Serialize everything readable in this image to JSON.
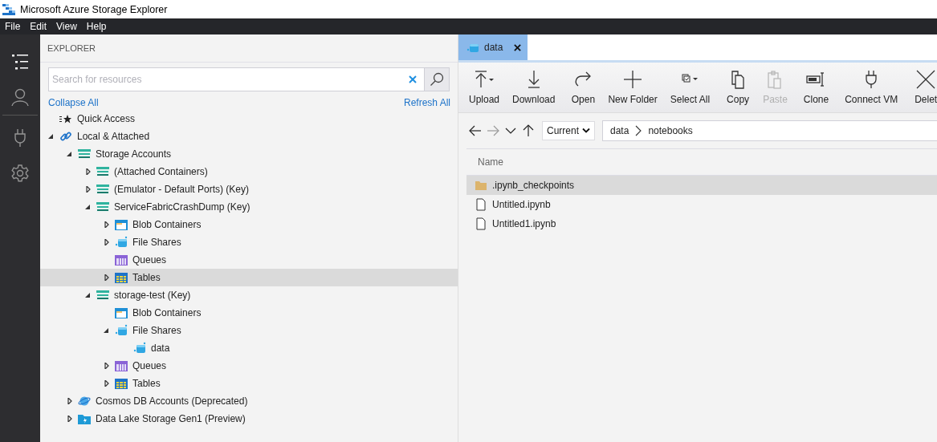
{
  "window": {
    "title": "Microsoft Azure Storage Explorer"
  },
  "menu": [
    "File",
    "Edit",
    "View",
    "Help"
  ],
  "activity_bar": [
    {
      "kind": "explorer",
      "selected": true
    },
    {
      "kind": "account",
      "selected": false
    },
    {
      "kind": "connect",
      "selected": false
    },
    {
      "kind": "settings",
      "selected": false
    }
  ],
  "explorer": {
    "heading": "EXPLORER",
    "search": {
      "placeholder": "Search for resources"
    },
    "collapse_all": "Collapse All",
    "refresh_all": "Refresh All",
    "tree": [
      {
        "label": "Quick Access",
        "kind": "quick",
        "selected": false
      },
      {
        "label": "Local & Attached",
        "kind": "link",
        "expanded": true,
        "selected": false,
        "children": [
          {
            "label": "Storage Accounts",
            "kind": "account",
            "expanded": true,
            "selected": false,
            "children": [
              {
                "label": "(Attached Containers)",
                "kind": "account",
                "expanded": false,
                "selected": false
              },
              {
                "label": "(Emulator - Default Ports) (Key)",
                "kind": "account",
                "expanded": false,
                "selected": false
              },
              {
                "label": "ServiceFabricCrashDump (Key)",
                "kind": "account",
                "expanded": true,
                "selected": false,
                "children": [
                  {
                    "label": "Blob Containers",
                    "kind": "blob",
                    "expanded": false,
                    "selected": false
                  },
                  {
                    "label": "File Shares",
                    "kind": "share",
                    "expanded": false,
                    "selected": false
                  },
                  {
                    "label": "Queues",
                    "kind": "queue",
                    "selected": false
                  },
                  {
                    "label": "Tables",
                    "kind": "table",
                    "expanded": false,
                    "selected": true
                  }
                ]
              },
              {
                "label": "storage-test (Key)",
                "kind": "account",
                "expanded": true,
                "selected": false,
                "children": [
                  {
                    "label": "Blob Containers",
                    "kind": "blob",
                    "selected": false
                  },
                  {
                    "label": "File Shares",
                    "kind": "share",
                    "expanded": true,
                    "selected": false,
                    "children": [
                      {
                        "label": "data",
                        "kind": "share",
                        "selected": false
                      }
                    ]
                  },
                  {
                    "label": "Queues",
                    "kind": "queue",
                    "expanded": false,
                    "selected": false
                  },
                  {
                    "label": "Tables",
                    "kind": "table",
                    "expanded": false,
                    "selected": false
                  }
                ]
              }
            ]
          },
          {
            "label": "Cosmos DB Accounts (Deprecated)",
            "kind": "cosmos",
            "expanded": false,
            "selected": false
          },
          {
            "label": "Data Lake Storage Gen1 (Preview)",
            "kind": "datalake",
            "expanded": false,
            "selected": false
          }
        ]
      }
    ]
  },
  "tabs": [
    {
      "label": "data",
      "selected": true
    }
  ],
  "toolbar": {
    "groups": [
      [
        {
          "label": "Upload",
          "kind": "upload",
          "disabled": false
        },
        {
          "label": "Download",
          "kind": "download",
          "disabled": false
        }
      ],
      [
        {
          "label": "Open",
          "kind": "open",
          "disabled": false
        },
        {
          "label": "New Folder",
          "kind": "newfolder",
          "disabled": false
        },
        {
          "label": "Select All",
          "kind": "selectall",
          "disabled": false
        }
      ],
      [
        {
          "label": "Copy",
          "kind": "copy",
          "disabled": false
        },
        {
          "label": "Paste",
          "kind": "paste",
          "disabled": true
        }
      ],
      [
        {
          "label": "Clone",
          "kind": "clone",
          "disabled": false
        }
      ],
      [
        {
          "label": "Connect VM",
          "kind": "connect",
          "disabled": false
        }
      ],
      [
        {
          "label": "Delet",
          "kind": "delete",
          "disabled": false
        }
      ]
    ]
  },
  "navigation": {
    "buttons": [
      {
        "kind": "back",
        "disabled": false
      },
      {
        "kind": "forward",
        "disabled": true
      },
      {
        "kind": "recent",
        "disabled": false
      },
      {
        "kind": "up",
        "disabled": false
      }
    ],
    "scope": "Current",
    "path": [
      "data",
      "notebooks"
    ]
  },
  "files": {
    "columns": [
      "Name"
    ],
    "rows": [
      {
        "name": ".ipynb_checkpoints",
        "kind": "folder",
        "selected": true
      },
      {
        "name": "Untitled.ipynb",
        "kind": "file",
        "selected": false
      },
      {
        "name": "Untitled1.ipynb",
        "kind": "file",
        "selected": false
      }
    ]
  }
}
